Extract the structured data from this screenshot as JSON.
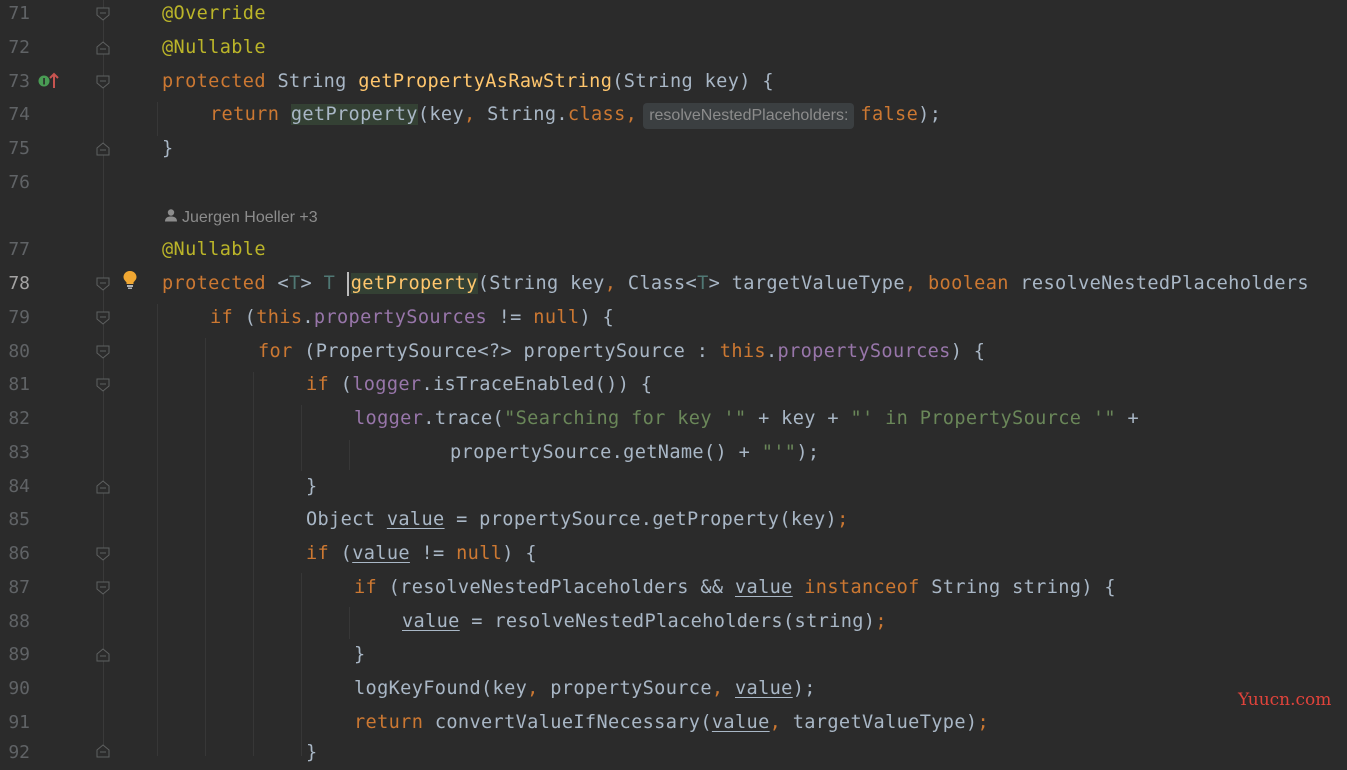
{
  "editor": {
    "line_numbers": [
      "71",
      "72",
      "73",
      "74",
      "75",
      "76",
      "77",
      "78",
      "79",
      "80",
      "81",
      "82",
      "83",
      "84",
      "85",
      "86",
      "87",
      "88",
      "89",
      "90",
      "91",
      "92"
    ],
    "current_line": "78",
    "author_hint": "Juergen Hoeller +3",
    "param_hint": "resolveNestedPlaceholders:",
    "watermark": "Yuucn.com",
    "icons": {
      "implements": "implements-up-arrow-icon",
      "intention": "lightbulb-icon",
      "person": "person-icon",
      "fold": "fold-marker-icon"
    },
    "code": {
      "l71": "@Override",
      "l72": "@Nullable",
      "l73": [
        "protected",
        " String ",
        "getPropertyAsRawString",
        "(String key) {"
      ],
      "l74": [
        "return",
        " ",
        "getProperty",
        "(key",
        ",",
        " String.",
        "class",
        ",",
        "false",
        ");"
      ],
      "l75": "}",
      "l77": "@Nullable",
      "l78": [
        "protected",
        " <",
        "T",
        "> ",
        "T",
        " ",
        "getProperty",
        "(String key",
        ",",
        " Class<",
        "T",
        "> targetValueType",
        ",",
        " ",
        "boolean",
        " resolveNestedPlaceholders"
      ],
      "l79": [
        "if",
        " (",
        "this",
        ".",
        "propertySources",
        " != ",
        "null",
        ") {"
      ],
      "l80": [
        "for",
        " (PropertySource<?> propertySource : ",
        "this",
        ".",
        "propertySources",
        ") {"
      ],
      "l81": [
        "if",
        " (",
        "logger",
        ".isTraceEnabled()) {"
      ],
      "l82": [
        "logger",
        ".trace(",
        "\"Searching for key '\"",
        " + key + ",
        "\"' in PropertySource '\"",
        " +"
      ],
      "l83": [
        "propertySource.getName() + ",
        "\"'\"",
        ");"
      ],
      "l84": "}",
      "l85": [
        "Object ",
        "value",
        " = propertySource.getProperty(key)",
        ";"
      ],
      "l86": [
        "if",
        " (",
        "value",
        " != ",
        "null",
        ") {"
      ],
      "l87": [
        "if",
        " (resolveNestedPlaceholders && ",
        "value",
        " ",
        "instanceof",
        " String string) {"
      ],
      "l88": [
        "value",
        " = resolveNestedPlaceholders(string)",
        ";"
      ],
      "l89": "}",
      "l90": [
        "logKeyFound(key",
        ",",
        " propertySource",
        ",",
        " ",
        "value",
        ");"
      ],
      "l91": [
        "return",
        " convertValueIfNecessary(",
        "value",
        ",",
        " targetValueType)",
        ";"
      ],
      "l92": "}"
    }
  }
}
